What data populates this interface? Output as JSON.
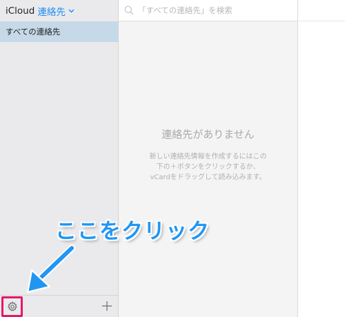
{
  "sidebar": {
    "app_name": "iCloud",
    "section": "連絡先",
    "groups": [
      {
        "label": "すべての連絡先",
        "selected": true
      }
    ]
  },
  "search": {
    "placeholder": "「すべての連絡先」を検索"
  },
  "empty_state": {
    "title": "連絡先がありません",
    "description": "新しい連絡先情報を作成するにはこの下の＋ボタンをクリックするか、vCardをドラッグして読み込みます。"
  },
  "annotation": {
    "text": "ここをクリック",
    "color": "#2196f3",
    "highlight_color": "#e5176a"
  },
  "icons": {
    "search": "search-icon",
    "settings": "gear-icon",
    "add": "plus-icon",
    "chevron": "chevron-down-icon"
  }
}
